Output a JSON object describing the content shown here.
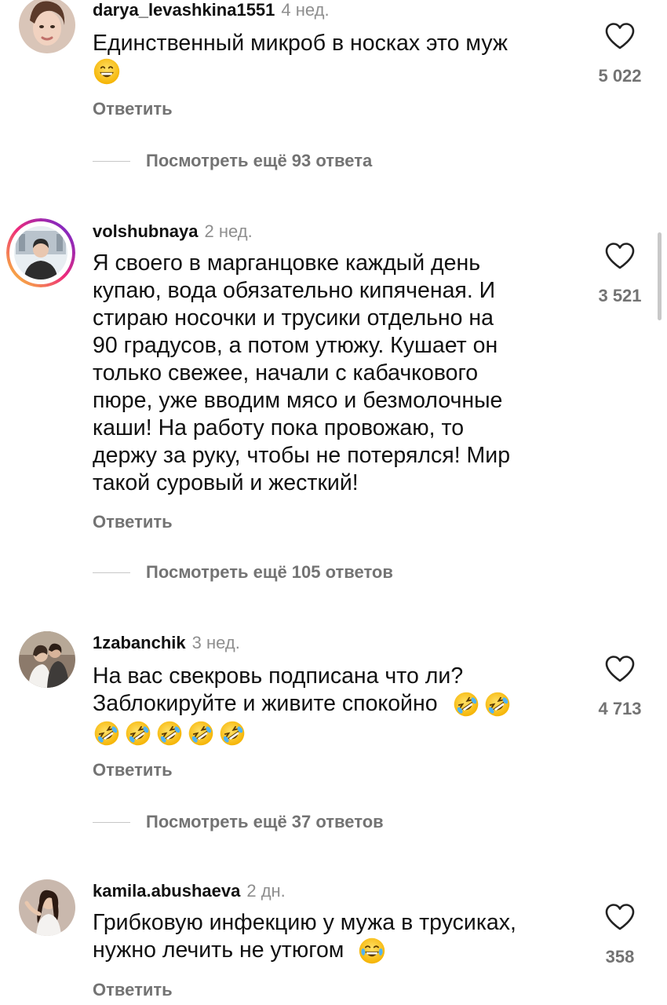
{
  "comments": [
    {
      "username": "darya_levashkina1551",
      "time": "4 нед.",
      "lines": [
        "Единственный микроб в носках это муж"
      ],
      "emojis": [
        "grinning-face"
      ],
      "likes": "5 022",
      "reply_label": "Ответить",
      "view_replies": "Посмотреть ещё 93 ответа"
    },
    {
      "username": "volshubnaya",
      "time": "2 нед.",
      "lines": [
        "Я своего в марганцовке каждый день",
        "купаю, вода обязательно кипяченая. И",
        "стираю носочки и трусики отдельно на",
        "90 градусов, а потом утюжу. Кушает он",
        "только свежее, начали с кабачкового",
        "пюре, уже вводим мясо и безмолочные",
        "каши! На работу пока провожаю, то",
        "держу за руку, чтобы не потерялся! Мир",
        "такой суровый и жесткий!"
      ],
      "likes": "3 521",
      "reply_label": "Ответить",
      "view_replies": "Посмотреть ещё 105 ответов"
    },
    {
      "username": "1zabanchik",
      "time": "3 нед.",
      "lines": [
        "На вас свекровь подписана что ли?",
        "Заблокируйте и живите спокойно"
      ],
      "emojis": [
        "rolling-on-floor-laughing",
        "rolling-on-floor-laughing",
        "rolling-on-floor-laughing",
        "rolling-on-floor-laughing",
        "rolling-on-floor-laughing",
        "rolling-on-floor-laughing",
        "rolling-on-floor-laughing"
      ],
      "likes": "4 713",
      "reply_label": "Ответить",
      "view_replies": "Посмотреть ещё 37 ответов"
    },
    {
      "username": "kamila.abushaeva",
      "time": "2 дн.",
      "lines": [
        "Грибковую инфекцию у мужа в трусиках,",
        "нужно лечить не утюгом"
      ],
      "emojis": [
        "face-with-tears-of-joy"
      ],
      "likes": "358",
      "reply_label": "Ответить"
    }
  ],
  "icons": {
    "like": "heart-outline-icon",
    "story_ring": "instagram-story-ring"
  },
  "colors": {
    "text": "#111111",
    "secondary": "#737373",
    "time": "#8e8e8e",
    "emoji_yellow": "#ffcc33",
    "ring_start": "#f9ce34",
    "ring_mid": "#ee2a7b",
    "ring_end": "#6228d7"
  }
}
